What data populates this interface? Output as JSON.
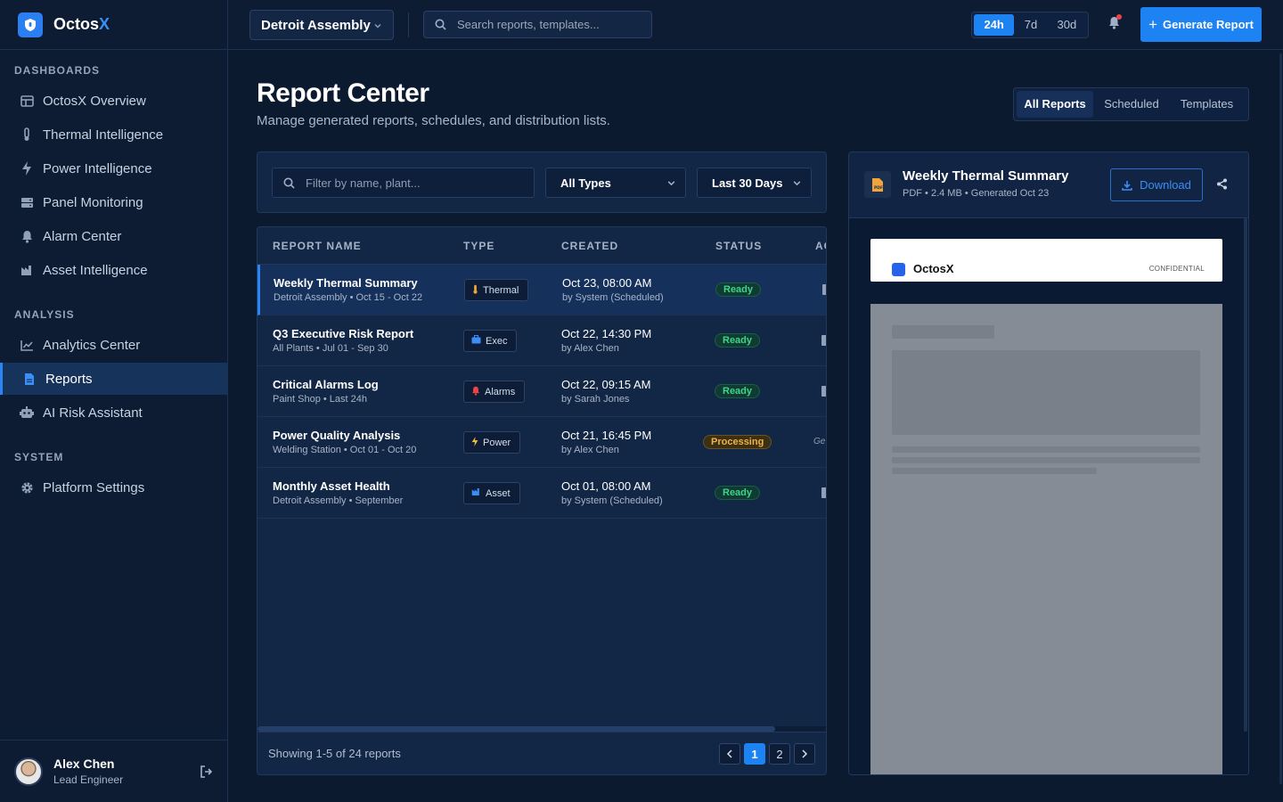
{
  "app": {
    "name_main": "Octos",
    "name_accent": "X"
  },
  "sidebar": {
    "sections": {
      "dashboards": "DASHBOARDS",
      "analysis": "ANALYSIS",
      "system": "SYSTEM"
    },
    "items": [
      {
        "label": "OctosX Overview",
        "icon": "layout-icon"
      },
      {
        "label": "Thermal Intelligence",
        "icon": "thermometer-icon"
      },
      {
        "label": "Power Intelligence",
        "icon": "bolt-icon"
      },
      {
        "label": "Panel Monitoring",
        "icon": "server-icon"
      },
      {
        "label": "Alarm Center",
        "icon": "bell-icon"
      },
      {
        "label": "Asset Intelligence",
        "icon": "factory-icon"
      },
      {
        "label": "Analytics Center",
        "icon": "chart-line-icon"
      },
      {
        "label": "Reports",
        "icon": "file-icon",
        "active": true
      },
      {
        "label": "AI Risk Assistant",
        "icon": "robot-icon"
      },
      {
        "label": "Platform Settings",
        "icon": "gear-icon"
      }
    ],
    "user": {
      "name": "Alex Chen",
      "role": "Lead Engineer"
    }
  },
  "topbar": {
    "plant": "Detroit Assembly",
    "search_placeholder": "Search reports, templates...",
    "ranges": [
      "24h",
      "7d",
      "30d"
    ],
    "active_range": "24h",
    "generate_label": "Generate Report"
  },
  "page": {
    "title": "Report Center",
    "subtitle": "Manage generated reports, schedules, and distribution lists.",
    "tabs": [
      "All Reports",
      "Scheduled",
      "Templates"
    ],
    "active_tab": "All Reports"
  },
  "filters": {
    "search_placeholder": "Filter by name, plant...",
    "type": "All Types",
    "range": "Last 30 Days"
  },
  "table": {
    "columns": [
      "REPORT NAME",
      "TYPE",
      "CREATED",
      "STATUS",
      "AC"
    ],
    "rows": [
      {
        "name": "Weekly Thermal Summary",
        "meta": "Detroit Assembly • Oct 15 - Oct 22",
        "type": "Thermal",
        "type_icon": "thermometer-icon",
        "created": "Oct 23, 08:00 AM",
        "by": "by System (Scheduled)",
        "status": "Ready"
      },
      {
        "name": "Q3 Executive Risk Report",
        "meta": "All Plants • Jul 01 - Sep 30",
        "type": "Exec",
        "type_icon": "briefcase-icon",
        "created": "Oct 22, 14:30 PM",
        "by": "by Alex Chen",
        "status": "Ready"
      },
      {
        "name": "Critical Alarms Log",
        "meta": "Paint Shop • Last 24h",
        "type": "Alarms",
        "type_icon": "bell-icon",
        "created": "Oct 22, 09:15 AM",
        "by": "by Sarah Jones",
        "status": "Ready"
      },
      {
        "name": "Power Quality Analysis",
        "meta": "Welding Station • Oct 01 - Oct 20",
        "type": "Power",
        "type_icon": "bolt-icon",
        "created": "Oct 21, 16:45 PM",
        "by": "by Alex Chen",
        "status": "Processing",
        "action": "Ge"
      },
      {
        "name": "Monthly Asset Health",
        "meta": "Detroit Assembly • September",
        "type": "Asset",
        "type_icon": "factory-icon",
        "created": "Oct 01, 08:00 AM",
        "by": "by System (Scheduled)",
        "status": "Ready"
      }
    ],
    "showing": "Showing 1-5 of 24 reports",
    "pages": [
      "1",
      "2"
    ],
    "current_page": "1"
  },
  "preview": {
    "title": "Weekly Thermal Summary",
    "meta": "PDF • 2.4 MB • Generated Oct 23",
    "download_label": "Download",
    "doc_brand": "OctosX",
    "doc_confidential": "CONFIDENTIAL"
  },
  "colors": {
    "accent": "#1d82f2",
    "ready": "#3fd48a",
    "processing": "#f2b33d",
    "background": "#0c1a30"
  }
}
